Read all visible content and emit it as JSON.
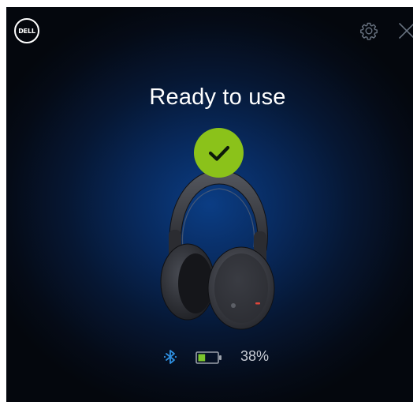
{
  "header": {
    "logo_text": "DELL",
    "settings_icon": "gear-icon",
    "close_icon": "close-icon"
  },
  "main": {
    "status_title": "Ready to use",
    "status_icon": "checkmark-icon",
    "device_image": "headphones-image"
  },
  "footer": {
    "connection_icon": "bluetooth-icon",
    "battery_icon": "battery-icon",
    "battery_percent": "38%",
    "battery_level": 0.38
  },
  "colors": {
    "accent_green": "#8bc21a",
    "bluetooth_blue": "#2e8fe0",
    "battery_green": "#7cc62d"
  }
}
